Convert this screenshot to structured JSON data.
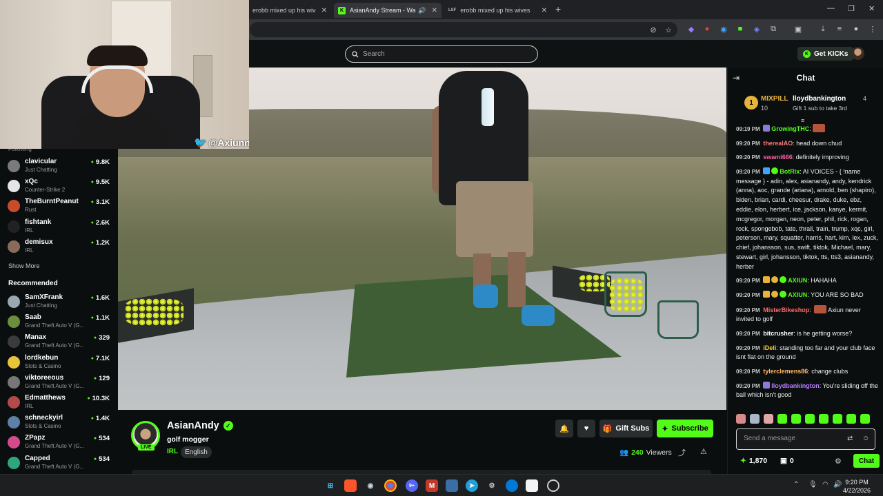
{
  "browser": {
    "tabs": [
      {
        "label": "erobb mixed up his wives : r/Liv",
        "favicon": "reddit"
      },
      {
        "label": "AsianAndy Stream - Watch",
        "favicon": "kick",
        "active": true
      },
      {
        "label": "erobb mixed up his wives",
        "favicon": "lsf"
      }
    ],
    "tab_badge_lsf": "LSF"
  },
  "header": {
    "search_placeholder": "Search",
    "get_kicks_label": "Get KICKs"
  },
  "webcam": {
    "twitter_handle": "@Axiunn"
  },
  "sidebar": {
    "following_partial": "Following",
    "following": [
      {
        "name": "clavicular",
        "category": "Just Chatting",
        "viewers": "9.8K",
        "color": "#7a7a7a"
      },
      {
        "name": "xQc",
        "category": "Counter-Strike 2",
        "viewers": "9.5K",
        "color": "#e5e5e5"
      },
      {
        "name": "TheBurntPeanut",
        "category": "Rust",
        "viewers": "3.1K",
        "color": "#c94b2a"
      },
      {
        "name": "fishtank",
        "category": "IRL",
        "viewers": "2.6K",
        "color": "#222"
      },
      {
        "name": "demisux",
        "category": "IRL",
        "viewers": "1.2K",
        "color": "#8a6b5a"
      }
    ],
    "show_more": "Show More",
    "recommended_title": "Recommended",
    "recommended": [
      {
        "name": "SamXFrank",
        "category": "Just Chatting",
        "viewers": "1.6K",
        "color": "#9aa7b0"
      },
      {
        "name": "Saab",
        "category": "Grand Theft Auto V (G...",
        "viewers": "1.1K",
        "color": "#6c8f3d"
      },
      {
        "name": "Manax",
        "category": "Grand Theft Auto V (G...",
        "viewers": "329",
        "color": "#3b3b3b"
      },
      {
        "name": "lordkebun",
        "category": "Slots & Casino",
        "viewers": "7.1K",
        "color": "#e8c43a"
      },
      {
        "name": "viktoreeous",
        "category": "Grand Theft Auto V (G...",
        "viewers": "129",
        "color": "#777"
      },
      {
        "name": "Edmatthews",
        "category": "IRL",
        "viewers": "10.3K",
        "color": "#b34a4a"
      },
      {
        "name": "schneckyirl",
        "category": "Slots & Casino",
        "viewers": "1.4K",
        "color": "#5e7fa6"
      },
      {
        "name": "ZPapz",
        "category": "Grand Theft Auto V (G...",
        "viewers": "534",
        "color": "#d44b8b"
      },
      {
        "name": "Capped",
        "category": "Grand Theft Auto V (G...",
        "viewers": "534",
        "color": "#2fa57a"
      }
    ]
  },
  "stream": {
    "streamer": "AsianAndy",
    "live_label": "LIVE",
    "title": "golf mogger",
    "category": "IRL",
    "language": "English",
    "gift_subs_label": "Gift Subs",
    "subscribe_label": "Subscribe",
    "viewer_count": "240",
    "viewers_label": "Viewers"
  },
  "chat": {
    "title": "Chat",
    "pinned": {
      "rank": "1",
      "gifter": "MIXPILL",
      "gifter_count": "10",
      "user": "lloydbankington",
      "user_count": "4",
      "cta": "Gift 1 sub to take 3rd"
    },
    "messages": [
      {
        "time": "09:19 PM",
        "user": "GrowingTHC",
        "color": "#53fc18",
        "text": "",
        "emote": true
      },
      {
        "time": "09:20 PM",
        "user": "therealAO",
        "color": "#ff7a7a",
        "text": "head down chud"
      },
      {
        "time": "09:20 PM",
        "user": "swami666",
        "color": "#ff5fa2",
        "text": "definitely improving"
      },
      {
        "time": "09:20 PM",
        "user": "BotRix",
        "color": "#53fc18",
        "text": "AI VOICES - { !name message } - adin, alex, asianandy, andy, kendrick (anna), aoc, grande (ariana), arnold, ben (shapiro), biden, brian, cardi, cheesur, drake, duke, ebz, eddie, elon, herbert, ice, jackson, kanye, kermit, mcgregor, morgan, neon, peter, phil, rick, rogan, rock, spongebob, tate, thrall, train, trump, xqc, girl, peterson, mary, squatter, harris, hart, kim, lex, zuck, chief, johansson, sus, swift, tiktok, Michael, mary, stewart, girl, johansson, tiktok, tts, tts3, asianandy, herber"
      },
      {
        "time": "09:20 PM",
        "user": "AXIUN",
        "color": "#53fc18",
        "text": "HAHAHA"
      },
      {
        "time": "09:20 PM",
        "user": "AXIUN",
        "color": "#53fc18",
        "text": "YOU ARE SO BAD"
      },
      {
        "time": "09:20 PM",
        "user": "MisterBikeshop",
        "color": "#ff6a6a",
        "text": "Axiun never invited to golf",
        "emote": true
      },
      {
        "time": "09:20 PM",
        "user": "bitcrusher",
        "color": "#ffffff",
        "text": "is he getting worse?"
      },
      {
        "time": "09:20 PM",
        "user": "iDeli",
        "color": "#f5d33d",
        "text": "standing too far and your club face isnt flat on the ground"
      },
      {
        "time": "09:20 PM",
        "user": "tylerclemens86",
        "color": "#ffb86b",
        "text": "change clubs"
      },
      {
        "time": "09:20 PM",
        "user": "lloydbankington",
        "color": "#b57bff",
        "text": "You're sliding off the ball which isn't good"
      }
    ],
    "input_placeholder": "Send a message",
    "points": "1,870",
    "drops": "0",
    "send_label": "Chat"
  },
  "taskbar": {
    "time": "9:20 PM",
    "date": "4/22/2026",
    "discord_badge": "9+"
  }
}
